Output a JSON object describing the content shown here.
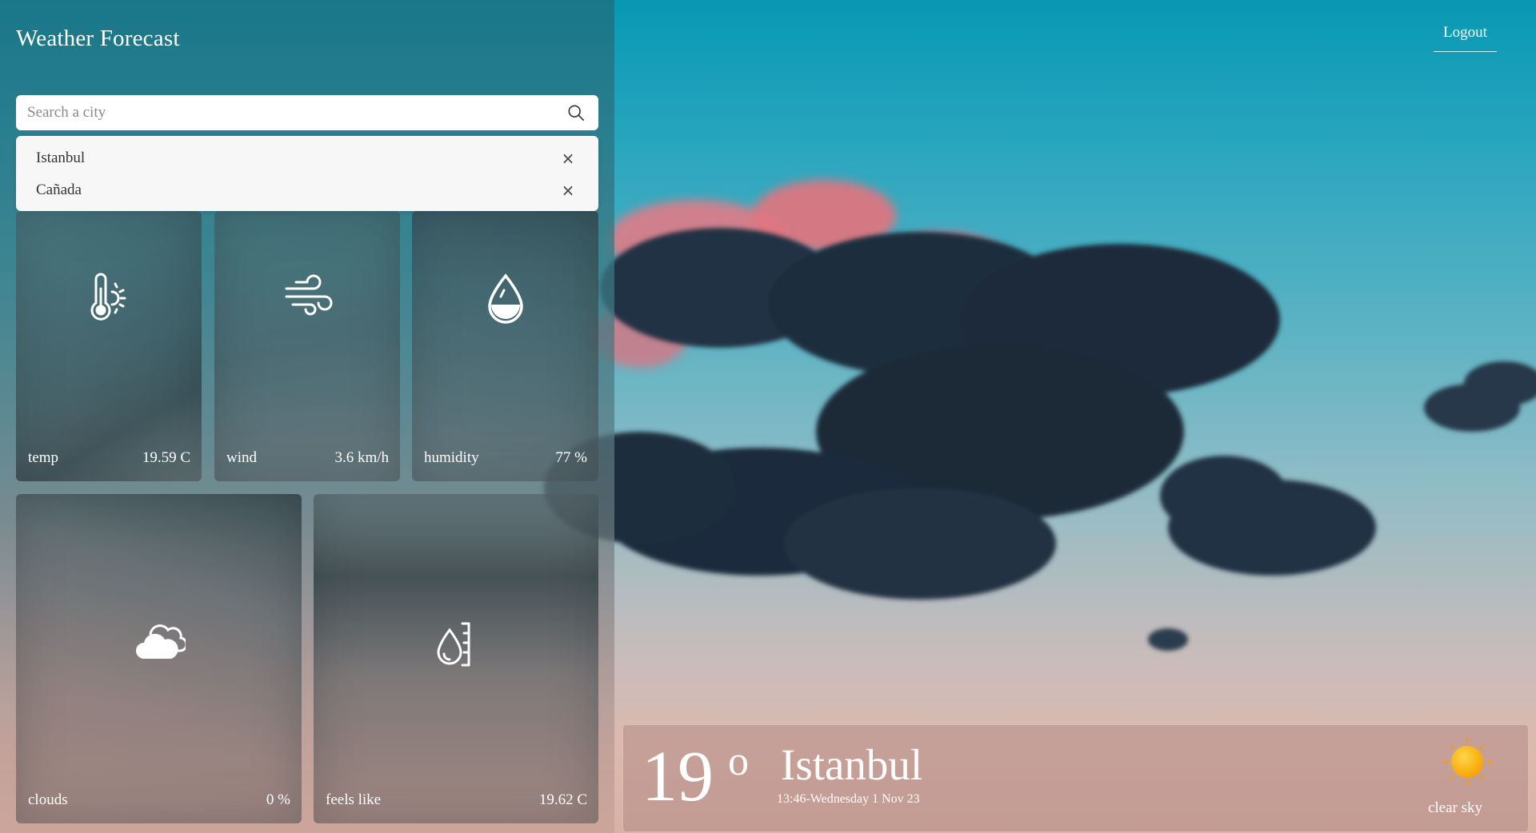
{
  "app": {
    "title": "Weather Forecast"
  },
  "search": {
    "placeholder": "Search a city",
    "icon": "search-icon"
  },
  "history": [
    {
      "city": "Istanbul",
      "remove": "×"
    },
    {
      "city": "Cañada",
      "remove": "×"
    }
  ],
  "cards": {
    "temp": {
      "label": "temp",
      "value": "19.59 C",
      "icon": "thermometer-sun-icon"
    },
    "wind": {
      "label": "wind",
      "value": "3.6 km/h",
      "icon": "wind-icon"
    },
    "humidity": {
      "label": "humidity",
      "value": "77 %",
      "icon": "water-drop-icon"
    },
    "clouds": {
      "label": "clouds",
      "value": "0 %",
      "icon": "cloud-icon"
    },
    "feels_like": {
      "label": "feels like",
      "value": "19.62 C",
      "icon": "drop-thermometer-icon"
    }
  },
  "header": {
    "logout": "Logout"
  },
  "current": {
    "temp": "19",
    "degree": "o",
    "city": "Istanbul",
    "datetime": "13:46-Wednesday 1 Nov 23",
    "description": "clear sky",
    "icon": "sun-icon"
  },
  "colors": {
    "sky_top": "#0898b3",
    "sky_bottom": "#d9b2a6",
    "cloud_dark": "#1f2f3f",
    "cloud_pink": "#e0707a",
    "sun": "#f5b800"
  }
}
